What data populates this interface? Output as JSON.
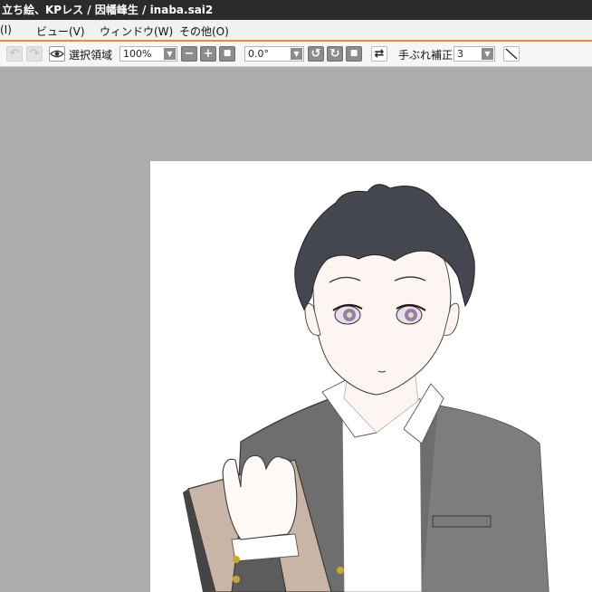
{
  "window": {
    "title": "立ち絵、KPレス / 因幡峰生 / inaba.sai2"
  },
  "menu": {
    "items": [
      "(I)",
      "ビュー(V)",
      "ウィンドウ(W)",
      "その他(O)"
    ]
  },
  "toolbar": {
    "selection_label": "選択領域",
    "zoom_value": "100%",
    "rotation_value": "0.0°",
    "stabilizer_label": "手ぶれ補正",
    "stabilizer_value": "3"
  },
  "colors": {
    "menu_accent": "#f08a3a",
    "canvas_bg": "#acacac",
    "titlebar": "#2b2b2b"
  },
  "icons": [
    "undo-icon",
    "redo-icon",
    "eye-icon",
    "zoom-out-icon",
    "zoom-in-icon",
    "zoom-reset-icon",
    "rotate-ccw-icon",
    "rotate-cw-icon",
    "rotate-reset-icon",
    "flip-icon",
    "pen-stroke-icon"
  ]
}
